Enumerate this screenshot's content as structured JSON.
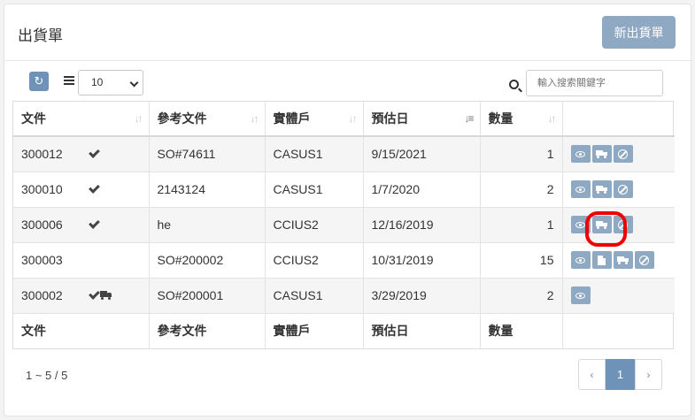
{
  "header": {
    "title": "出貨單",
    "new_button": "新出貨單"
  },
  "toolbar": {
    "page_size": "10",
    "search_placeholder": "輸入搜索關鍵字"
  },
  "table": {
    "columns": [
      "文件",
      "參考文件",
      "實體戶",
      "預估日",
      "數量"
    ],
    "rows": [
      {
        "doc": "300012",
        "ref": "SO#74611",
        "entity": "CASUS1",
        "date": "9/15/2021",
        "qty": "1"
      },
      {
        "doc": "300010",
        "ref": "2143124",
        "entity": "CASUS1",
        "date": "1/7/2020",
        "qty": "2"
      },
      {
        "doc": "300006",
        "ref": "he",
        "entity": "CCIUS2",
        "date": "12/16/2019",
        "qty": "1"
      },
      {
        "doc": "300003",
        "ref": "SO#200002",
        "entity": "CCIUS2",
        "date": "10/31/2019",
        "qty": "15"
      },
      {
        "doc": "300002",
        "ref": "SO#200001",
        "entity": "CASUS1",
        "date": "3/29/2019",
        "qty": "2"
      }
    ]
  },
  "footer": {
    "range": "1 ~ 5 / 5",
    "prev": "‹",
    "page": "1",
    "next": "›"
  }
}
